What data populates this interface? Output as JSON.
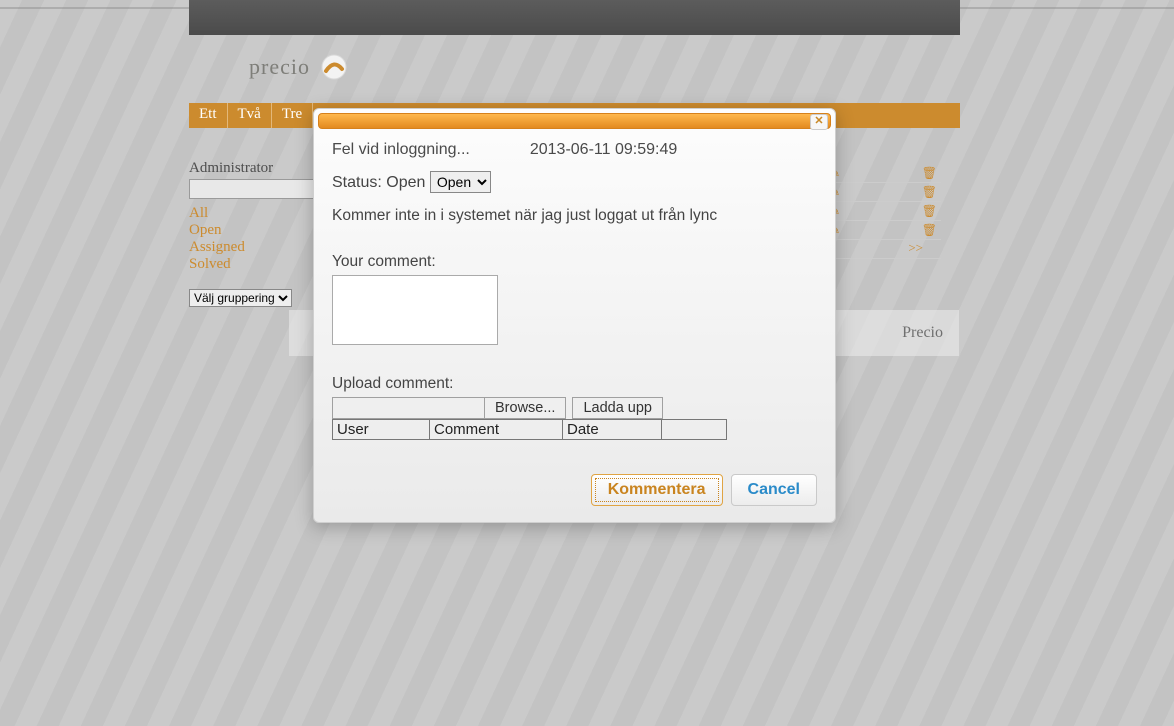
{
  "brand": {
    "name": "precio",
    "footer": "Precio"
  },
  "nav": {
    "items": [
      "Ett",
      "Två",
      "Tre"
    ]
  },
  "sidebar": {
    "admin_label": "Administrator",
    "search_value": "",
    "filters": [
      "All",
      "Open",
      "Assigned",
      "Solved"
    ],
    "grouping_selected": "Välj gruppering",
    "grouping_options": [
      "Välj gruppering"
    ]
  },
  "rows": {
    "pager_next": ">>"
  },
  "dialog": {
    "title": "Fel vid inloggning...",
    "timestamp": "2013-06-11 09:59:49",
    "status_label": "Status:",
    "status_value": "Open",
    "status_options": [
      "Open"
    ],
    "description": "Kommer inte in i systemet när jag just loggat ut från lync",
    "comment_label": "Your comment:",
    "comment_value": "",
    "upload_label": "Upload comment:",
    "browse_label": "Browse...",
    "upload_button": "Ladda upp",
    "table": {
      "headers": [
        "User",
        "Comment",
        "Date",
        ""
      ]
    },
    "primary_button": "Kommentera",
    "cancel_button": "Cancel",
    "close_glyph": "✕"
  }
}
